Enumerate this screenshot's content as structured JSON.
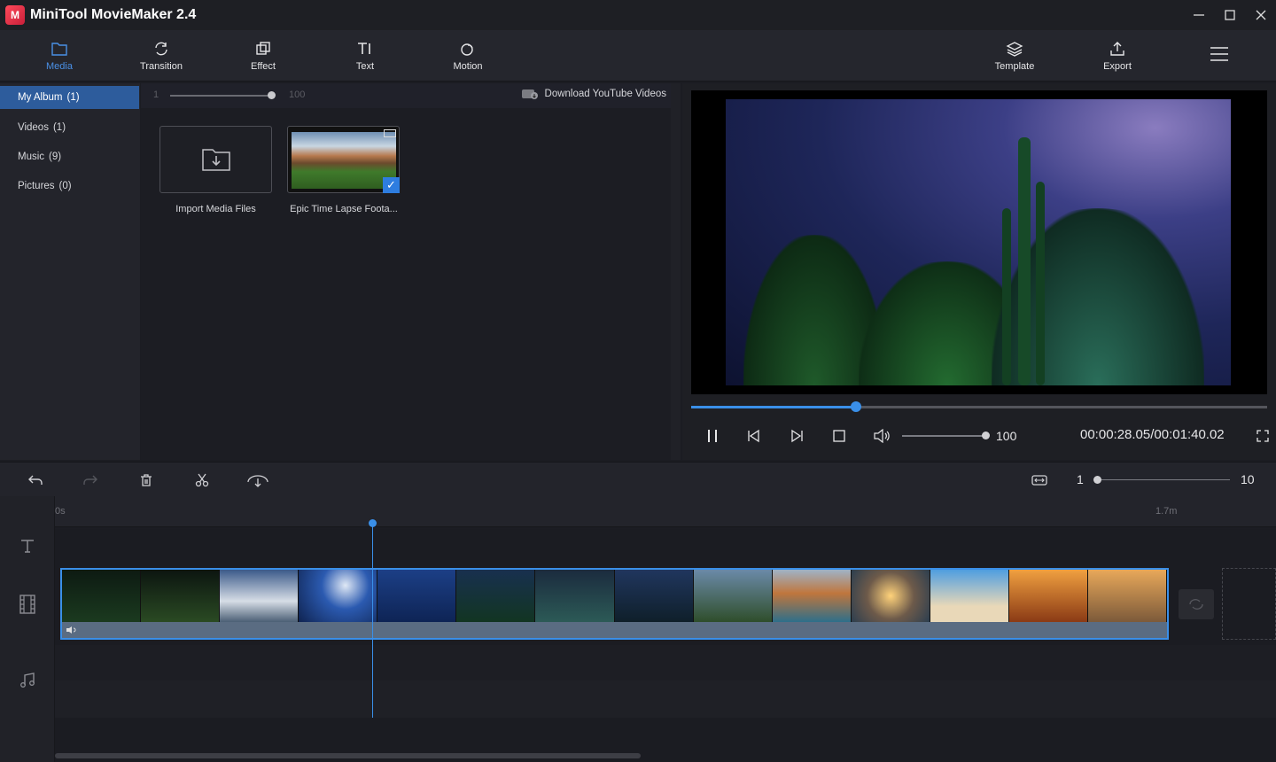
{
  "app": {
    "title": "MiniTool MovieMaker 2.4",
    "logo_letter": "M"
  },
  "window_controls": [
    "minimize-icon",
    "maximize-icon",
    "close-icon"
  ],
  "toolbar": {
    "tabs": [
      {
        "label": "Media",
        "icon": "folder-icon",
        "active": true
      },
      {
        "label": "Transition",
        "icon": "transition-icon"
      },
      {
        "label": "Effect",
        "icon": "effect-icon"
      },
      {
        "label": "Text",
        "icon": "text-icon"
      },
      {
        "label": "Motion",
        "icon": "motion-icon"
      }
    ],
    "right": [
      {
        "label": "Template",
        "icon": "layers-icon"
      },
      {
        "label": "Export",
        "icon": "export-icon"
      }
    ]
  },
  "sidebar": {
    "items": [
      {
        "label": "My Album",
        "count": "(1)",
        "active": true
      },
      {
        "label": "Videos",
        "count": "(1)"
      },
      {
        "label": "Music",
        "count": "(9)"
      },
      {
        "label": "Pictures",
        "count": "(0)"
      }
    ]
  },
  "media": {
    "size_min": "1",
    "size_max": "100",
    "download_label": "Download YouTube Videos",
    "import_label": "Import Media Files",
    "clip_label": "Epic Time Lapse Foota..."
  },
  "player": {
    "progress": 0.286,
    "volume": "100",
    "timecode": "00:00:28.05/00:01:40.02"
  },
  "timeline": {
    "zoom_min": "1",
    "zoom_max": "10",
    "ruler_start": "0s",
    "ruler_end": "1.7m"
  },
  "colors": {
    "accent": "#3a8fe8",
    "active_nav": "#2d5c9c"
  }
}
